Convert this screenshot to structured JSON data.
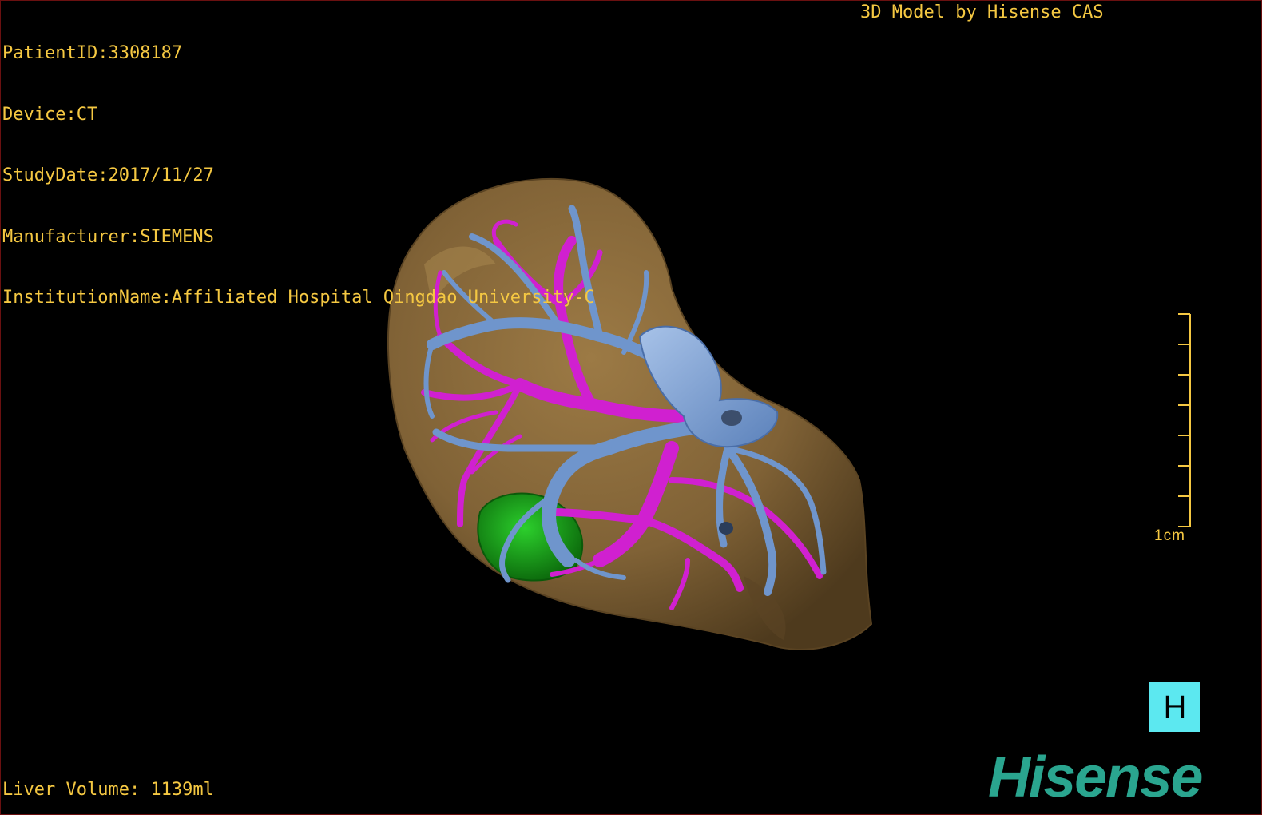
{
  "dicom": {
    "patient_id": "PatientID:3308187",
    "device": "Device:CT",
    "study_date": "StudyDate:2017/11/27",
    "manufacturer": "Manufacturer:SIEMENS",
    "institution": "InstitutionName:Affiliated Hospital Qingdao University-C"
  },
  "credit": "3D Model by Hisense CAS",
  "liver_volume": "Liver Volume: 1139ml",
  "scale": {
    "label": "1cm"
  },
  "orientation_marker": "H",
  "brand": "Hisense",
  "colors": {
    "overlay_text": "#f5c842",
    "liver": "#8a6a3c",
    "portal_vein": "#6f95cc",
    "hepatic_artery": "#d020d0",
    "tumor": "#1fa01f",
    "orientation_box": "#5ce8f0",
    "brand": "#2aa58f"
  }
}
